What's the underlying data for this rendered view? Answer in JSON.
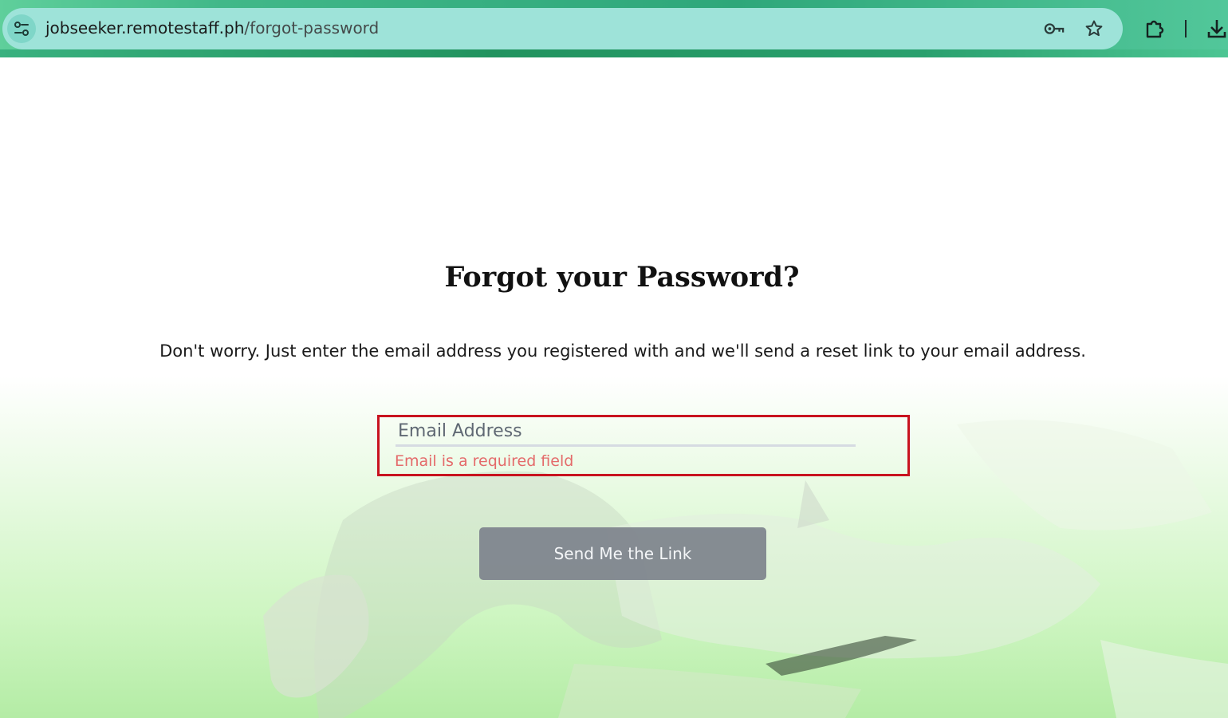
{
  "browser": {
    "url_host": "jobseeker.remotestaff.ph",
    "url_path": "/forgot-password",
    "icons": [
      "site-settings-icon",
      "password-key-icon",
      "bookmark-star-icon",
      "extensions-puzzle-icon",
      "download-icon"
    ]
  },
  "page": {
    "title": "Forgot your Password?",
    "description": "Don't worry. Just enter the email address you registered with and we'll send a reset link to your email address.",
    "email_field": {
      "placeholder": "Email Address",
      "value": "",
      "error": "Email is a required field"
    },
    "submit_label": "Send Me the Link"
  },
  "colors": {
    "browser_accent": "#41b889",
    "omnibox": "#9ee3d9",
    "error_border": "#c8131f",
    "error_text": "#e46a6a",
    "button_bg": "#80868e",
    "background_tint": "#cbf5be"
  }
}
